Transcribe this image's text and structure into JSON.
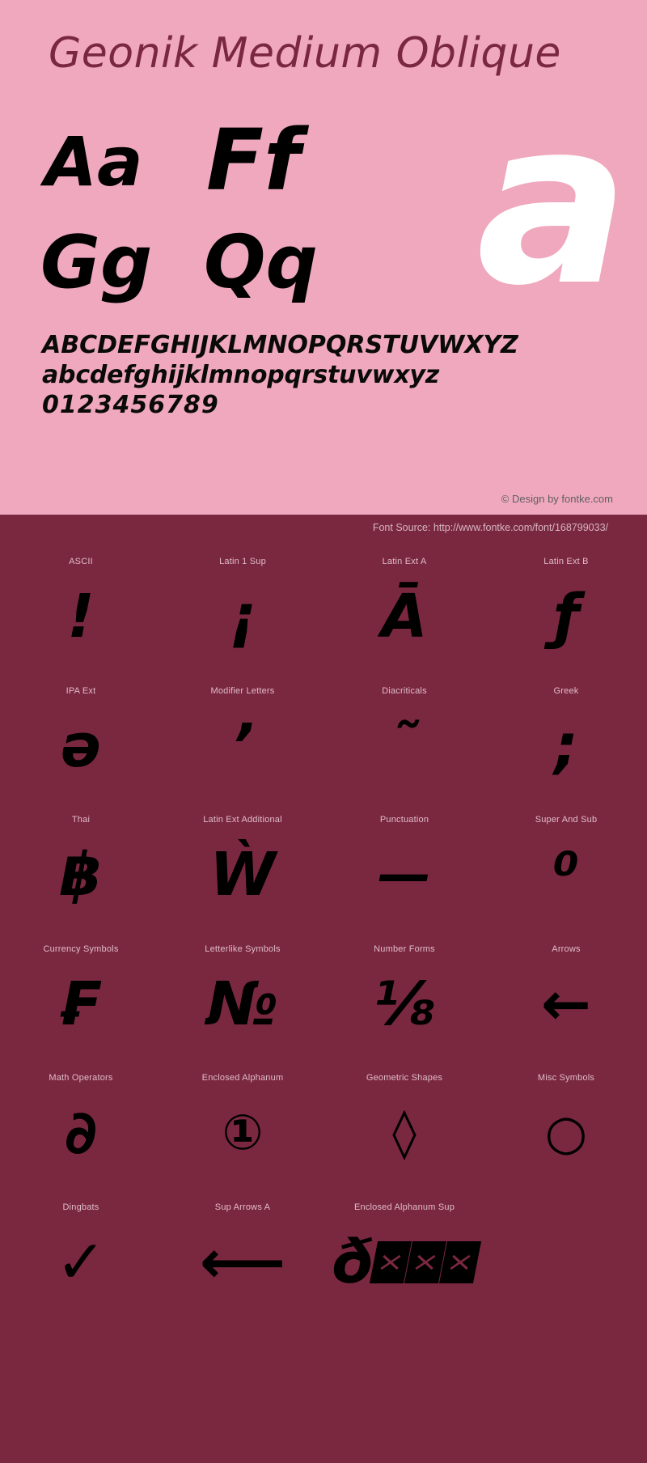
{
  "header": {
    "title": "Geonik Medium Oblique"
  },
  "preview": {
    "letter_pairs": [
      {
        "name": "pair-aa",
        "text": "Aa"
      },
      {
        "name": "pair-ff",
        "text": "Ff"
      },
      {
        "name": "pair-gg",
        "text": "Gg"
      },
      {
        "name": "pair-qq",
        "text": "Qq"
      }
    ],
    "hero_glyph": "a",
    "charset": {
      "uppercase": "ABCDEFGHIJKLMNOPQRSTUVWXYZ",
      "lowercase": "abcdefghijklmnopqrstuvwxyz",
      "digits": "0123456789"
    },
    "design_credit": "© Design by fontke.com"
  },
  "source": {
    "label": "Font Source: http://www.fontke.com/font/168799033/"
  },
  "glyph_map": {
    "rows": [
      {
        "cells": [
          {
            "label": "ASCII",
            "glyph": "!"
          },
          {
            "label": "Latin 1 Sup",
            "glyph": "¡"
          },
          {
            "label": "Latin Ext A",
            "glyph": "Ā"
          },
          {
            "label": "Latin Ext B",
            "glyph": "ƒ"
          }
        ]
      },
      {
        "cells": [
          {
            "label": "IPA Ext",
            "glyph": "ə"
          },
          {
            "label": "Modifier Letters",
            "glyph": "ʼ"
          },
          {
            "label": "Diacriticals",
            "glyph": "˜"
          },
          {
            "label": "Greek",
            "glyph": ";"
          }
        ]
      },
      {
        "cells": [
          {
            "label": "Thai",
            "glyph": "฿"
          },
          {
            "label": "Latin Ext Additional",
            "glyph": "Ẁ"
          },
          {
            "label": "Punctuation",
            "glyph": "—"
          },
          {
            "label": "Super And Sub",
            "glyph": "⁰"
          }
        ]
      },
      {
        "cells": [
          {
            "label": "Currency Symbols",
            "glyph": "₣"
          },
          {
            "label": "Letterlike Symbols",
            "glyph": "№"
          },
          {
            "label": "Number Forms",
            "glyph": "⅛"
          },
          {
            "label": "Arrows",
            "glyph": "←"
          }
        ]
      },
      {
        "cells": [
          {
            "label": "Math Operators",
            "glyph": "∂"
          },
          {
            "label": "Enclosed Alphanum",
            "glyph": "①"
          },
          {
            "label": "Geometric Shapes",
            "glyph": "◊"
          },
          {
            "label": "Misc Symbols",
            "glyph": "○"
          }
        ]
      },
      {
        "cells": [
          {
            "label": "Dingbats",
            "glyph": "✓"
          },
          {
            "label": "Sup Arrows A",
            "glyph": "⟵"
          },
          {
            "label": "Enclosed Alphanum Sup",
            "glyph": "ð"
          },
          {
            "label": "",
            "glyph": ""
          }
        ]
      }
    ]
  },
  "colors": {
    "preview_background": "#f0a8be",
    "accent_dark": "#7a2840",
    "title_text": "#7a2840",
    "glyph_black": "#000000",
    "hero_white": "#ffffff",
    "map_label": "#e0bcc8",
    "credit_text": "#5f5f63",
    "source_text": "#d7b6c1"
  }
}
